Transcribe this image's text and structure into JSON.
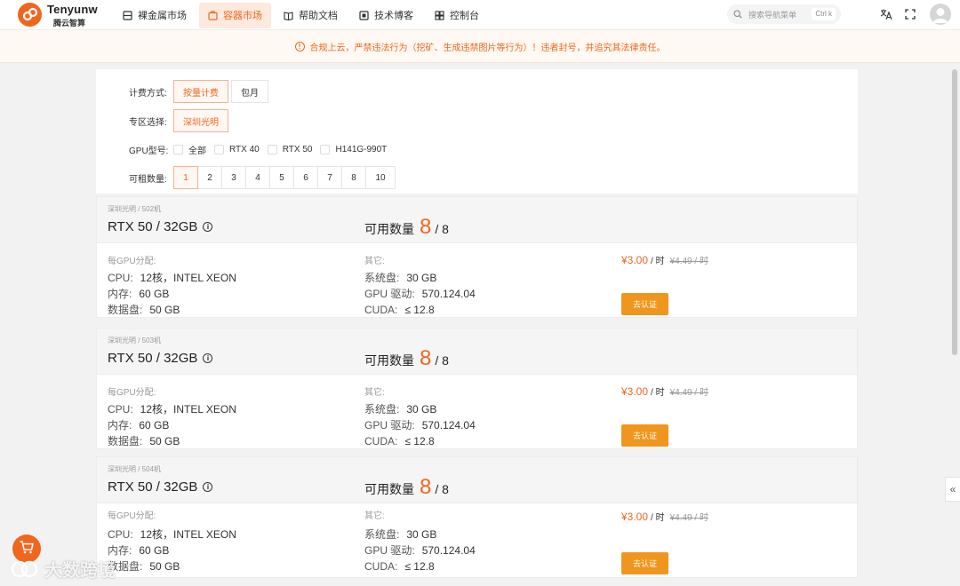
{
  "brand": {
    "name": "Tenyunw",
    "sub": "腾云智算",
    "color": "#f0661e"
  },
  "nav": [
    {
      "label": "裸金属市场",
      "icon": "server-icon",
      "active": false
    },
    {
      "label": "容器市场",
      "icon": "container-icon",
      "active": true
    },
    {
      "label": "帮助文档",
      "icon": "book-icon",
      "active": false
    },
    {
      "label": "技术博客",
      "icon": "blog-icon",
      "active": false
    },
    {
      "label": "控制台",
      "icon": "dashboard-icon",
      "active": false
    }
  ],
  "search": {
    "placeholder": "搜索导航菜单",
    "shortcut": "Ctrl k"
  },
  "notice": {
    "icon": "!",
    "text": "合规上云，严禁违法行为（挖矿、生成违禁图片等行为）！违者封号，并追究其法律责任。"
  },
  "filters": {
    "billing": {
      "label": "计费方式:",
      "options": [
        "按量计费",
        "包月"
      ],
      "selected": 0
    },
    "zone": {
      "label": "专区选择:",
      "options": [
        "深圳光明"
      ],
      "selected": 0
    },
    "gpu": {
      "label": "GPU型号:",
      "options": [
        "全部",
        "RTX 40",
        "RTX 50",
        "H141G-990T"
      ]
    },
    "count": {
      "label": "可租数量:",
      "options": [
        "1",
        "2",
        "3",
        "4",
        "5",
        "6",
        "7",
        "8",
        "10"
      ],
      "selected": 0
    }
  },
  "cards": [
    {
      "crumb": "深圳光明 / 502机",
      "gpu": "RTX 50 / 32GB",
      "avail_label": "可用数量",
      "avail": "8",
      "total": "/ 8",
      "alloc_title": "每GPU分配:",
      "cpu_k": "CPU:",
      "cpu_v": "12核，INTEL XEON",
      "mem_k": "内存:",
      "mem_v": "60 GB",
      "disk_k": "数据盘:",
      "disk_v": "50 GB",
      "other_title": "其它:",
      "sys_k": "系统盘:",
      "sys_v": "30 GB",
      "drv_k": "GPU 驱动:",
      "drv_v": "570.124.04",
      "cuda_k": "CUDA:",
      "cuda_v": "≤ 12.8",
      "price": "¥3.00",
      "unit": "/ 时",
      "old_price": "¥4.49 / 时",
      "button": "去认证"
    },
    {
      "crumb": "深圳光明 / 503机",
      "gpu": "RTX 50 / 32GB",
      "avail_label": "可用数量",
      "avail": "8",
      "total": "/ 8",
      "alloc_title": "每GPU分配:",
      "cpu_k": "CPU:",
      "cpu_v": "12核，INTEL XEON",
      "mem_k": "内存:",
      "mem_v": "60 GB",
      "disk_k": "数据盘:",
      "disk_v": "50 GB",
      "other_title": "其它:",
      "sys_k": "系统盘:",
      "sys_v": "30 GB",
      "drv_k": "GPU 驱动:",
      "drv_v": "570.124.04",
      "cuda_k": "CUDA:",
      "cuda_v": "≤ 12.8",
      "price": "¥3.00",
      "unit": "/ 时",
      "old_price": "¥4.49 / 时",
      "button": "去认证"
    },
    {
      "crumb": "深圳光明 / 504机",
      "gpu": "RTX 50 / 32GB",
      "avail_label": "可用数量",
      "avail": "8",
      "total": "/ 8",
      "alloc_title": "每GPU分配:",
      "cpu_k": "CPU:",
      "cpu_v": "12核，INTEL XEON",
      "mem_k": "内存:",
      "mem_v": "60 GB",
      "disk_k": "数据盘:",
      "disk_v": "50 GB",
      "other_title": "其它:",
      "sys_k": "系统盘:",
      "sys_v": "30 GB",
      "drv_k": "GPU 驱动:",
      "drv_v": "570.124.04",
      "cuda_k": "CUDA:",
      "cuda_v": "≤ 12.8",
      "price": "¥3.00",
      "unit": "/ 时",
      "old_price": "¥4.49 / 时",
      "button": "去认证"
    }
  ],
  "collapse_glyph": "«",
  "watermark": "大数跨境"
}
